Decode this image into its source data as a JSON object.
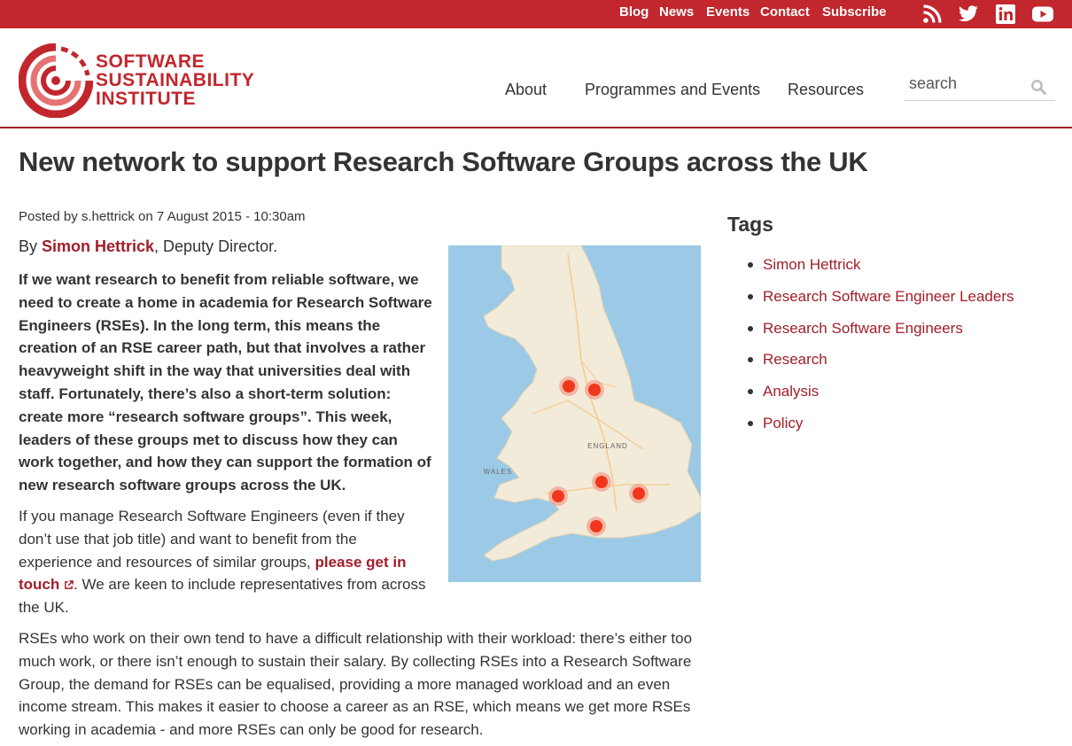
{
  "topbar": {
    "links": [
      "Blog",
      "News",
      "Events",
      "Contact",
      "Subscribe"
    ],
    "social_icons": [
      "rss-icon",
      "twitter-icon",
      "linkedin-icon",
      "youtube-icon"
    ],
    "background": "#c1272d"
  },
  "logo": {
    "line1": "SOFTWARE",
    "line2": "SUSTAINABILITY",
    "line3": "INSTITUTE",
    "color": "#c1272d"
  },
  "nav": {
    "about": "About",
    "programmes": "Programmes and Events",
    "resources": "Resources"
  },
  "search": {
    "placeholder": "search"
  },
  "article": {
    "title": "New network to support Research Software Groups across the UK",
    "meta": "Posted by s.hettrick on 7 August 2015 - 10:30am",
    "byline_prefix": "By ",
    "author": "Simon Hettrick",
    "byline_suffix": ", Deputy Director.",
    "lead": "If we want research to benefit from reliable software, we need to create a home in academia for Research Software Engineers (RSEs). In the long term, this means the creation of an RSE career path, but that involves a rather heavyweight shift in the way that universities deal with staff. Fortunately, there’s also a short-term solution: create more “research software groups”. This week, leaders of these groups met to discuss how they can work together, and how they can support the formation of new research software groups across the UK.",
    "para2_before": "If you manage Research Software Engineers (even if they don’t use that job title) and want to benefit from the experience and resources of similar groups, ",
    "para2_link": "please get in touch",
    "para2_after": ". We are keen to include representatives from across the UK.",
    "para3": "RSEs who work on their own tend to have a difficult relationship with their workload: there’s either too much work, or there isn’t enough to sustain their salary. By collecting RSEs into a Research Software Group, the demand for RSEs can be equalised, providing a more managed workload and an even income stream. This makes it easier to choose a career as an RSE, which means we get more RSEs working in academia - and more RSEs can only be good for research."
  },
  "map": {
    "labels": {
      "england": "ENGLAND",
      "wales": "WALES"
    }
  },
  "tags": {
    "heading": "Tags",
    "items": [
      "Simon Hettrick",
      "Research Software Engineer Leaders",
      "Research Software Engineers",
      "Research",
      "Analysis",
      "Policy"
    ]
  }
}
